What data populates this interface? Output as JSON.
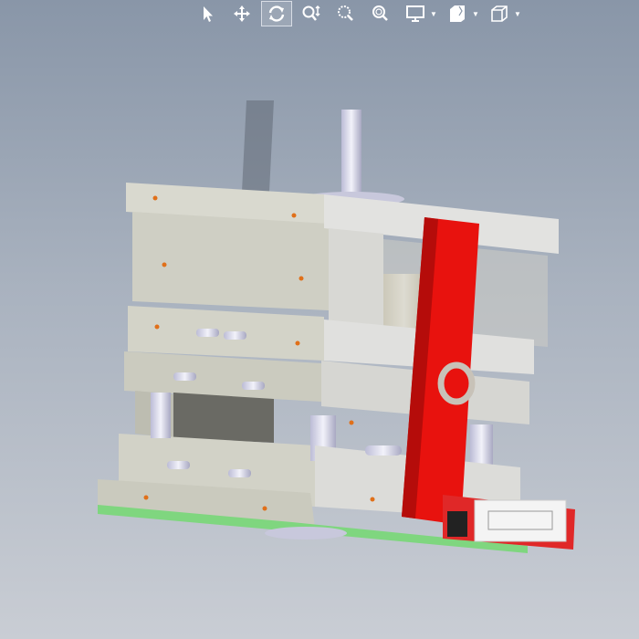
{
  "toolbar": {
    "items": [
      {
        "icon": "select-arrow-icon",
        "active": false
      },
      {
        "icon": "pan-icon",
        "active": false
      },
      {
        "icon": "rotate-icon",
        "active": true
      },
      {
        "icon": "zoom-in-out-icon",
        "active": false
      },
      {
        "icon": "zoom-to-area-icon",
        "active": false
      },
      {
        "icon": "zoom-to-fit-icon",
        "active": false
      },
      {
        "icon": "display-style-icon",
        "active": false,
        "dropdown": true
      },
      {
        "icon": "section-view-icon",
        "active": false,
        "dropdown": true
      },
      {
        "icon": "view-orientation-icon",
        "active": false,
        "dropdown": true
      }
    ]
  },
  "colors": {
    "plate": "#d3d3c9",
    "plate_dark": "#b9b9ad",
    "red_bar": "#e8120e",
    "green_edge": "#7fd67f",
    "background_top": "#8996a8",
    "background_bottom": "#c9cdd4"
  }
}
